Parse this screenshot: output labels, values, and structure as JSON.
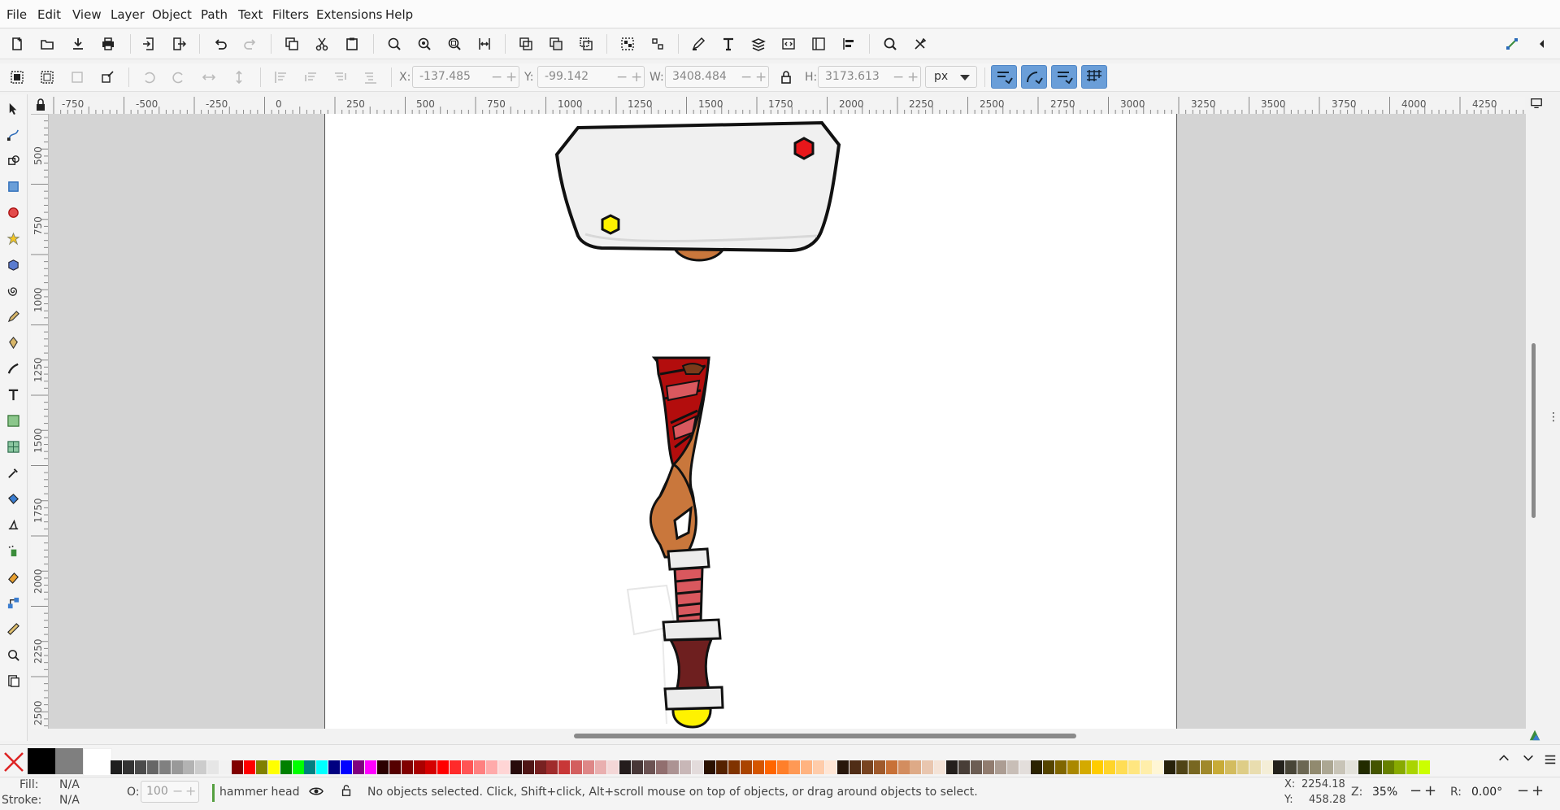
{
  "menu": [
    "File",
    "Edit",
    "View",
    "Layer",
    "Object",
    "Path",
    "Text",
    "Filters",
    "Extensions",
    "Help"
  ],
  "controls": {
    "x_label": "X:",
    "x_value": "-137.485",
    "y_label": "Y:",
    "y_value": "-99.142",
    "w_label": "W:",
    "w_value": "3408.484",
    "h_label": "H:",
    "h_value": "3173.613",
    "unit": "px"
  },
  "ruler": {
    "h_labels": [
      "-750",
      "-500",
      "-250",
      "0",
      "250",
      "500",
      "750",
      "1000",
      "1250",
      "1500",
      "1750",
      "2000",
      "2250",
      "2500",
      "2750",
      "3000",
      "3250",
      "3500",
      "3750",
      "4000",
      "4250"
    ],
    "v_labels": [
      "500",
      "750",
      "1000",
      "1250",
      "1500",
      "1750",
      "2000",
      "2250",
      "2500"
    ]
  },
  "palette": {
    "colors": [
      "#000000",
      "#7f7f7f",
      "#ffffff",
      "#1e1e1e",
      "#333333",
      "#4c4c4c",
      "#666666",
      "#808080",
      "#999999",
      "#b3b3b3",
      "#cccccc",
      "#e6e6e6",
      "#f2f2f2",
      "#800000",
      "#ff0000",
      "#808000",
      "#ffff00",
      "#008000",
      "#00ff00",
      "#008080",
      "#00ffff",
      "#000080",
      "#0000ff",
      "#800080",
      "#ff00ff",
      "#2b0000",
      "#550000",
      "#800000",
      "#aa0000",
      "#d40000",
      "#ff0000",
      "#ff2a2a",
      "#ff5555",
      "#ff8080",
      "#ffaaaa",
      "#ffd5d5",
      "#280b0b",
      "#501616",
      "#782121",
      "#a02c2c",
      "#c83737",
      "#d35f5f",
      "#de8787",
      "#e9afaf",
      "#f4d7d7",
      "#241c1c",
      "#483737",
      "#6c5353",
      "#916f6f",
      "#ac9393",
      "#c8b7b7",
      "#e3dbdb",
      "#2b1100",
      "#552200",
      "#803300",
      "#aa4400",
      "#d45500",
      "#ff6600",
      "#ff7f2a",
      "#ff9955",
      "#ffb380",
      "#ffccaa",
      "#ffe6d5",
      "#28170b",
      "#502d16",
      "#784421",
      "#a05a2c",
      "#c87137",
      "#d38d5f",
      "#deaa87",
      "#e9c6af",
      "#f4e3d7",
      "#241f1c",
      "#483e37",
      "#6c5d53",
      "#917c6f",
      "#ac9d93",
      "#c8beb7",
      "#e3dedb",
      "#2b2200",
      "#554400",
      "#806600",
      "#aa8800",
      "#d4aa00",
      "#ffcc00",
      "#ffd42a",
      "#ffdd55",
      "#ffe680",
      "#ffeeaa",
      "#fff6d5",
      "#28220b",
      "#504416",
      "#786721",
      "#a0892c",
      "#c8ab37",
      "#d3bc5f",
      "#decd87",
      "#e9ddaf",
      "#f4eed7",
      "#24221c",
      "#484537",
      "#6c6753",
      "#918a6f",
      "#aca793",
      "#c8c4b7",
      "#e3e2db",
      "#222b00",
      "#445500",
      "#668000",
      "#88aa00",
      "#aad400",
      "#ccff00"
    ]
  },
  "status": {
    "fill_label": "Fill:",
    "fill_value": "N/A",
    "stroke_label": "Stroke:",
    "stroke_value": "N/A",
    "opacity_label": "O:",
    "opacity_value": "100",
    "layer_name": "hammer head",
    "message": "No objects selected. Click, Shift+click, Alt+scroll mouse on top of objects, or drag around objects to select.",
    "x_label": "X:",
    "x_value": "2254.18",
    "y_label": "Y:",
    "y_value": "458.28",
    "zoom_label": "Z:",
    "zoom_value": "35%",
    "rotate_label": "R:",
    "rotate_value": "0.00°"
  },
  "colors": {
    "accent": "#6a9ed8",
    "hammer_face": "#f0f0f0",
    "gem_red": "#e8171b",
    "gem_yellow": "#fff200",
    "wood": "#c9773c",
    "wrap_red": "#b30d0d",
    "grip_pink": "#d9585e"
  }
}
